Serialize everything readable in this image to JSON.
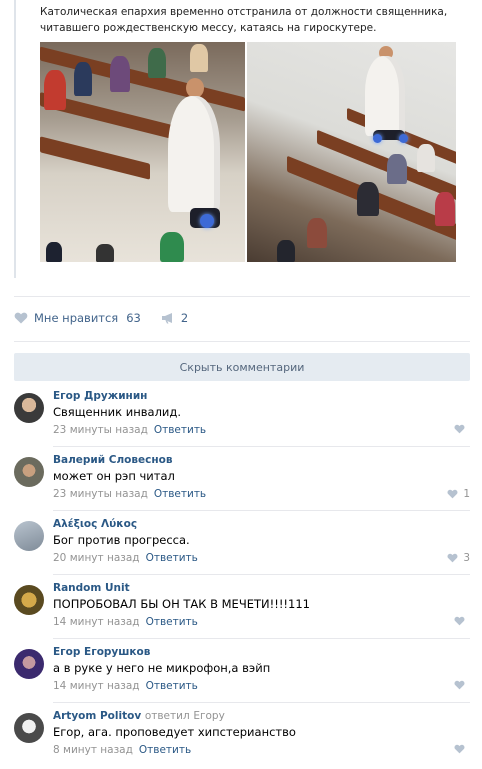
{
  "post": {
    "text": "Католическая епархия временно отстранила от должности священника, читавшего рождественскую мессу, катаясь на гироскутере."
  },
  "actions": {
    "like_label": "Мне нравится",
    "like_count": "63",
    "share_count": "2"
  },
  "hide_comments_label": "Скрыть комментарии",
  "comments": [
    {
      "author": "Егор Дружинин",
      "text": "Священник инвалид.",
      "time": "23 минуты назад",
      "reply_label": "Ответить",
      "likes": ""
    },
    {
      "author": "Валерий Словеснов",
      "text": "может он рэп читал",
      "time": "23 минуты назад",
      "reply_label": "Ответить",
      "likes": "1"
    },
    {
      "author": "Αλέξιος Λύκος",
      "text": "Бог против прогресса.",
      "time": "20 минут назад",
      "reply_label": "Ответить",
      "likes": "3"
    },
    {
      "author": "Random Unit",
      "text": "ПОПРОБОВАЛ БЫ ОН ТАК В МЕЧЕТИ!!!!111",
      "time": "14 минут назад",
      "reply_label": "Ответить",
      "likes": ""
    },
    {
      "author": "Егор Егорушков",
      "text": "а в руке у него не микрофон,а вэйп",
      "time": "14 минут назад",
      "reply_label": "Ответить",
      "likes": ""
    },
    {
      "author": "Artyom Politov",
      "replied": "ответил",
      "reply_to": "Егору",
      "text": "Егор, ага. проповедует хипстерианство",
      "time": "8 минут назад",
      "reply_label": "Ответить",
      "likes": ""
    }
  ],
  "colors": {
    "link": "#2a5885",
    "meta": "#939393",
    "button_bg": "#e5ebf1",
    "divider": "#e7e8ec"
  }
}
